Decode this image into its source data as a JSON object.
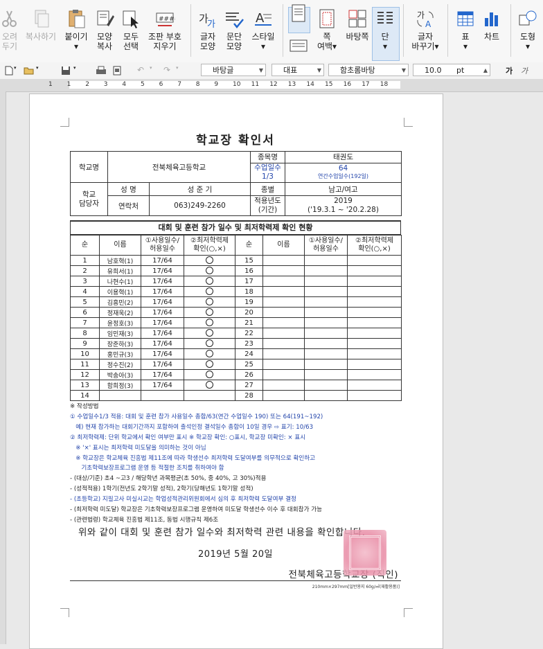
{
  "ribbon": {
    "items": [
      {
        "label": "오려\n두기",
        "disabled": true
      },
      {
        "label": "복사하기",
        "disabled": true
      },
      {
        "label": "붙이기\n▾"
      },
      {
        "label": "모양\n복사"
      },
      {
        "label": "모두\n선택"
      },
      {
        "label": "조판 부호\n지우기"
      },
      {
        "label": "글자\n모양"
      },
      {
        "label": "문단\n모양"
      },
      {
        "label": "스타일\n▾"
      },
      {
        "label": ""
      },
      {
        "label": "쪽\n여백▾"
      },
      {
        "label": "바탕쪽"
      },
      {
        "label": "단\n▾"
      },
      {
        "label": "글자\n바꾸기▾"
      },
      {
        "label": "표\n▾"
      },
      {
        "label": "차트"
      },
      {
        "label": "도형\n▾"
      }
    ]
  },
  "toolbar": {
    "style": "바탕글",
    "font_lang": "대표",
    "font": "함초롬바탕",
    "size": "10.0",
    "unit": "pt",
    "ga1": "가",
    "ga2": "가"
  },
  "ruler": {
    "ticks": [
      "1",
      "1",
      "2",
      "3",
      "4",
      "5",
      "6",
      "7",
      "8",
      "9",
      "10",
      "11",
      "12",
      "13",
      "14",
      "15",
      "16",
      "17",
      "18"
    ]
  },
  "doc": {
    "title": "학교장 확인서",
    "school_label": "학교명",
    "school": "전북체육고등학교",
    "event_label": "종목명",
    "event": "태권도",
    "days_label": "수업일수\n1/3",
    "days_value": "64",
    "days_note": "연간수업일수(192일)",
    "manager_label": "학교\n담당자",
    "name_label": "성 명",
    "name": "성 준 기",
    "gender_label": "종별",
    "gender": "남고/여고",
    "contact_label": "연락처",
    "contact": "063)249-2260",
    "year_label": "적용년도\n(기간)",
    "year": "2019",
    "period": "('19.3.1 ~ '20.2.28)",
    "section_title": "대회 및 훈련 참가 일수 및 최저학력제 확인 현황",
    "headers": [
      "순",
      "이름",
      "①사용일수/\n허용일수",
      "②최저학력제\n확인(○,×)",
      "순",
      "이름",
      "①사용일수/\n허용일수",
      "②최저학력제\n확인(○,×)"
    ],
    "rows": [
      {
        "no": "1",
        "name": "남호혁(1)",
        "days": "17/64",
        "ok": true,
        "no2": "15"
      },
      {
        "no": "2",
        "name": "유희서(1)",
        "days": "17/64",
        "ok": true,
        "no2": "16"
      },
      {
        "no": "3",
        "name": "나현수(1)",
        "days": "17/64",
        "ok": true,
        "no2": "17"
      },
      {
        "no": "4",
        "name": "이용혁(1)",
        "days": "17/64",
        "ok": true,
        "no2": "18"
      },
      {
        "no": "5",
        "name": "김흥민(2)",
        "days": "17/64",
        "ok": true,
        "no2": "19"
      },
      {
        "no": "6",
        "name": "정재욱(2)",
        "days": "17/64",
        "ok": true,
        "no2": "20"
      },
      {
        "no": "7",
        "name": "윤정호(3)",
        "days": "17/64",
        "ok": true,
        "no2": "21"
      },
      {
        "no": "8",
        "name": "임민재(3)",
        "days": "17/64",
        "ok": true,
        "no2": "22"
      },
      {
        "no": "9",
        "name": "장준하(3)",
        "days": "17/64",
        "ok": true,
        "no2": "23"
      },
      {
        "no": "10",
        "name": "홍민규(3)",
        "days": "17/64",
        "ok": true,
        "no2": "24"
      },
      {
        "no": "11",
        "name": "정수진(2)",
        "days": "17/64",
        "ok": true,
        "no2": "25"
      },
      {
        "no": "12",
        "name": "박송아(3)",
        "days": "17/64",
        "ok": true,
        "no2": "26"
      },
      {
        "no": "13",
        "name": "함희정(3)",
        "days": "17/64",
        "ok": true,
        "no2": "27"
      },
      {
        "no": "14",
        "name": "",
        "days": "",
        "ok": false,
        "no2": "28"
      }
    ],
    "notes": [
      {
        "t": "※ 작성방법",
        "c": ""
      },
      {
        "t": "① 수업일수1/3 적용: 대회 및 훈련 참가 사용일수 총합/63(연간 수업일수 190) 또는 64(191~192)",
        "c": "b"
      },
      {
        "t": "   예) 현재 참가하는 대회기간까지 포함하여 출석인정 결석일수 총합이 10일 경우 ⇨ 표기: 10/63",
        "c": "b"
      },
      {
        "t": "② 최저학력제: 단위 학교에서 확인 여부만 표시 ※ 학교장 확인: ○표시, 학교장 미확인: × 표시",
        "c": "b"
      },
      {
        "t": "   ※ '×' 표시는 최저학력 미도달을 의미하는 것이 아님",
        "c": "b"
      },
      {
        "t": "   ※ 학교장은 학교체육 진흥법 제11조에 따라 학생선수 최저학력 도달여부를 의무적으로 확인하고",
        "c": "b"
      },
      {
        "t": "      기초학력보장프로그램 운영 등 적절한 조치를 취하여야 함",
        "c": "b"
      },
      {
        "t": "- (대상/기준) 초4 ~고3 / 해당학년 과목평균(초 50%, 중 40%, 고 30%)적용",
        "c": ""
      },
      {
        "t": "- (성적적용) 1학기(전년도 2학기말 성적), 2학기(당해년도 1학기말 성적)",
        "c": ""
      },
      {
        "t": "- (초등학교) 지필고사 미실시교는 학업성적관리위원회에서 심의 후 최저학력 도달여부 결정",
        "c": "b"
      },
      {
        "t": "- (최저학력 미도달) 학교장은 기초학력보장프로그램 운영하여 미도달 학생선수 이수 후 대회참가 가능",
        "c": ""
      },
      {
        "t": "- (관련법령) 학교체육 진흥법 제11조, 동법 시행규칙 제6조",
        "c": ""
      }
    ],
    "confirm": "위와 같이 대회 및 훈련 참가 일수와 최저학력 관련 내용을 확인합니다.",
    "date": "2019년 5월  20일",
    "principal": "전북체육고등학교장        (직인)",
    "footer": "210mm×297mm[일반용지 60g/㎡(재활용품)]"
  },
  "colors": {
    "accent": "#2244aa",
    "seal": "#e88aa4"
  }
}
